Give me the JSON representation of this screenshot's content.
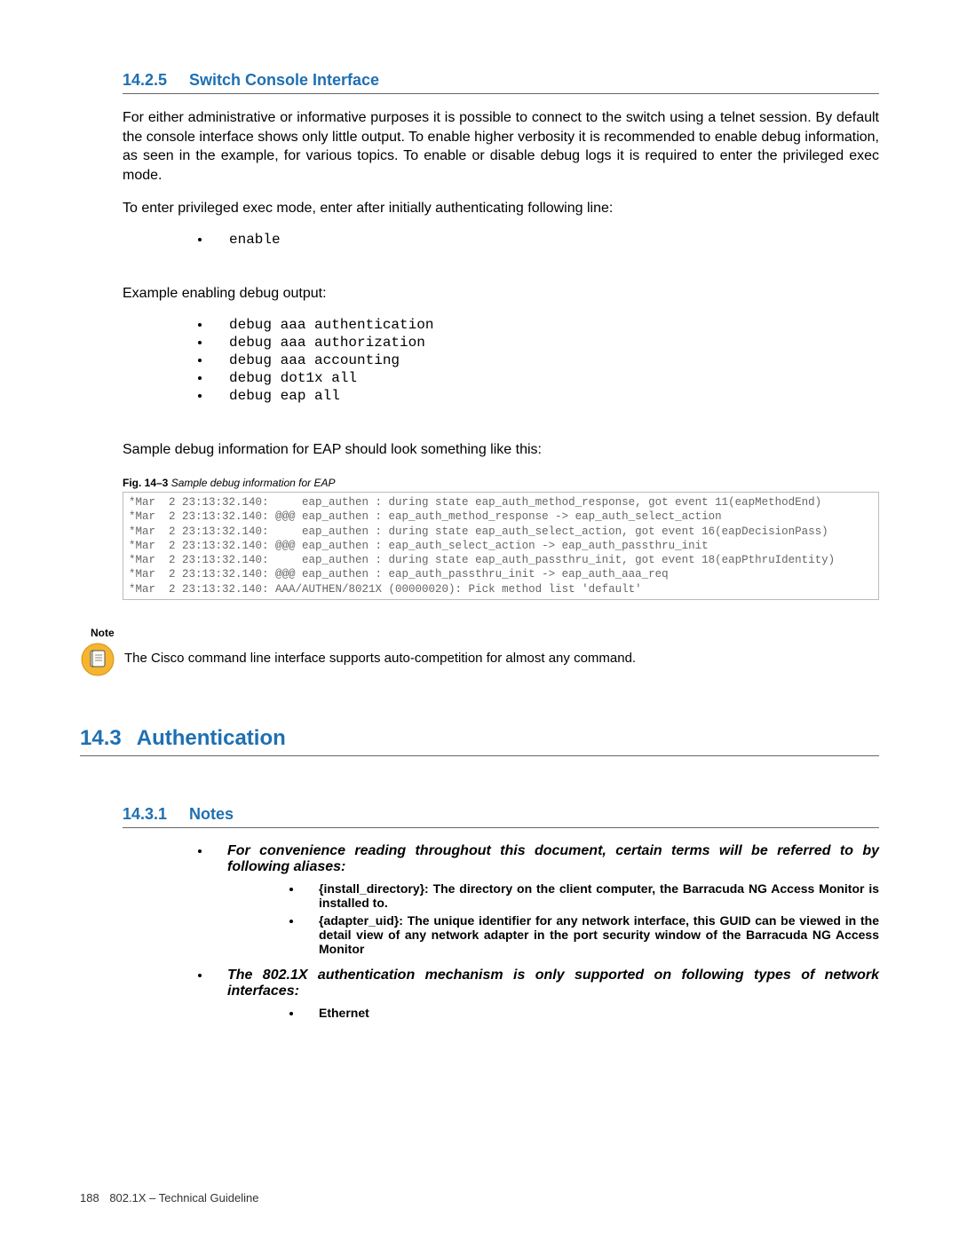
{
  "section1": {
    "num": "14.2.5",
    "title": "Switch Console Interface",
    "para1": "For either administrative or informative purposes it is possible to connect to the switch using a telnet session. By default the console interface shows only little output. To enable higher verbosity it is recommended to enable debug information, as seen in the example, for various topics. To enable or disable debug logs it is required to enter the privileged exec mode.",
    "para2": "To enter privileged exec mode, enter after initially authenticating following line:",
    "cmd1": [
      "enable"
    ],
    "para3": "Example enabling debug output:",
    "cmd2": [
      "debug aaa authentication",
      "debug aaa authorization",
      "debug aaa accounting",
      "debug dot1x all",
      "debug eap all"
    ],
    "para4": "Sample debug information for EAP should look something like this:",
    "fig": {
      "label": "Fig. 14–3",
      "title": "Sample debug information for EAP"
    },
    "code": "*Mar  2 23:13:32.140:     eap_authen : during state eap_auth_method_response, got event 11(eapMethodEnd)\n*Mar  2 23:13:32.140: @@@ eap_authen : eap_auth_method_response -> eap_auth_select_action\n*Mar  2 23:13:32.140:     eap_authen : during state eap_auth_select_action, got event 16(eapDecisionPass)\n*Mar  2 23:13:32.140: @@@ eap_authen : eap_auth_select_action -> eap_auth_passthru_init\n*Mar  2 23:13:32.140:     eap_authen : during state eap_auth_passthru_init, got event 18(eapPthruIdentity)\n*Mar  2 23:13:32.140: @@@ eap_authen : eap_auth_passthru_init -> eap_auth_aaa_req\n*Mar  2 23:13:32.140: AAA/AUTHEN/8021X (00000020): Pick method list 'default'"
  },
  "note": {
    "label": "Note",
    "text": "The Cisco command line interface supports auto-competition for almost any command."
  },
  "section2": {
    "num": "14.3",
    "title": "Authentication"
  },
  "section3": {
    "num": "14.3.1",
    "title": "Notes",
    "item1": "For convenience reading throughout this document, certain terms will be referred to by following aliases:",
    "sub1a_term": "{install_directory}:",
    "sub1a_text": " The directory on the client computer, the Barracuda NG Access Monitor is installed to.",
    "sub1b_term": "{adapter_uid}:",
    "sub1b_text": " The unique identifier for any network interface, this GUID can be viewed in the detail view of any network adapter in the port security window of the Barracuda NG Access Monitor",
    "item2": "The 802.1X authentication mechanism is only supported on following types of network interfaces:",
    "sub2a": "Ethernet"
  },
  "footer": {
    "page": "188",
    "title": "802.1X – Technical Guideline"
  }
}
